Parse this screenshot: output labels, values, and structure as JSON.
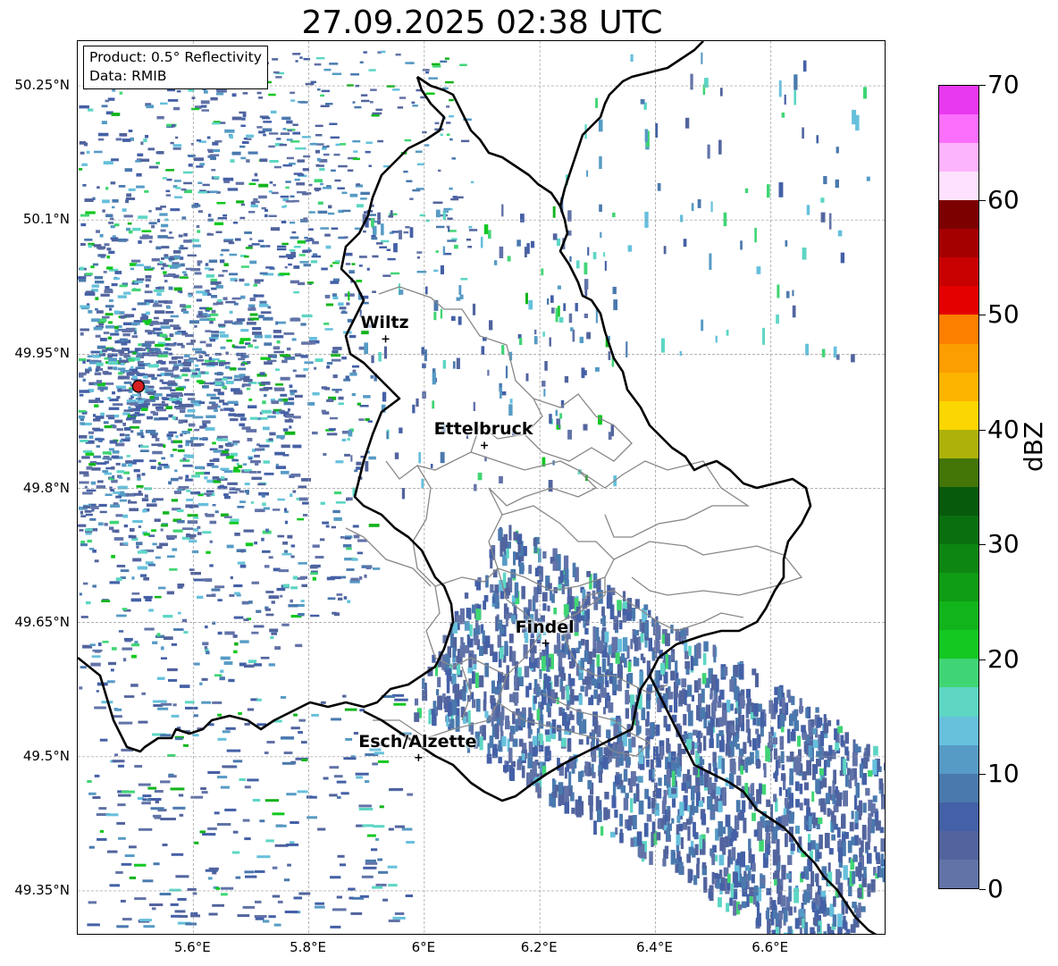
{
  "title": "27.09.2025 02:38 UTC",
  "info_box": {
    "product": "Product: 0.5° Reflectivity",
    "data_source": "Data: RMIB"
  },
  "map": {
    "extent": {
      "lon_min": 5.4,
      "lon_max": 6.8,
      "lat_min": 49.3,
      "lat_max": 50.3
    },
    "lat_ticks": [
      {
        "value": 50.25,
        "label": "50.25°N"
      },
      {
        "value": 50.1,
        "label": "50.1°N"
      },
      {
        "value": 49.95,
        "label": "49.95°N"
      },
      {
        "value": 49.8,
        "label": "49.8°N"
      },
      {
        "value": 49.65,
        "label": "49.65°N"
      },
      {
        "value": 49.5,
        "label": "49.5°N"
      },
      {
        "value": 49.35,
        "label": "49.35°N"
      }
    ],
    "lon_ticks": [
      {
        "value": 5.6,
        "label": "5.6°E"
      },
      {
        "value": 5.8,
        "label": "5.8°E"
      },
      {
        "value": 6.0,
        "label": "6°E"
      },
      {
        "value": 6.2,
        "label": "6.2°E"
      },
      {
        "value": 6.4,
        "label": "6.4°E"
      },
      {
        "value": 6.6,
        "label": "6.6°E"
      }
    ],
    "grid": true,
    "radar_site": {
      "lon": 5.505,
      "lat": 49.914,
      "color": "#d62020"
    },
    "cities": [
      {
        "name": "Wiltz",
        "lon": 5.933,
        "lat": 49.967
      },
      {
        "name": "Ettelbruck",
        "lon": 6.104,
        "lat": 49.848
      },
      {
        "name": "Findel",
        "lon": 6.21,
        "lat": 49.627
      },
      {
        "name": "Esch/Alzette",
        "lon": 5.99,
        "lat": 49.499
      }
    ],
    "border_color": "#000000",
    "district_color": "#888888"
  },
  "colorbar": {
    "label": "dBZ",
    "min": 0,
    "max": 70,
    "ticks": [
      "0",
      "10",
      "20",
      "30",
      "40",
      "50",
      "60",
      "70"
    ],
    "colors": [
      "#6273a8",
      "#52649e",
      "#4460a6",
      "#4a79ae",
      "#569bc5",
      "#66c0dc",
      "#5dd6c4",
      "#40d574",
      "#12c821",
      "#12b41c",
      "#0e9d14",
      "#0e8612",
      "#0a700f",
      "#075a0b",
      "#437507",
      "#adb10a",
      "#fcd600",
      "#fcb400",
      "#fc9d00",
      "#fc7f00",
      "#e50000",
      "#c80000",
      "#a50000",
      "#7d0000",
      "#fde1fe",
      "#fcb4fc",
      "#fc6efc",
      "#e838f0"
    ]
  }
}
